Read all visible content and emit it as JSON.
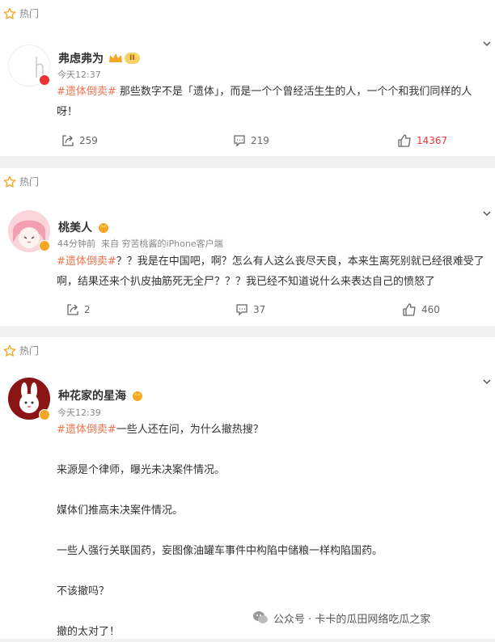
{
  "hot_label": "热门",
  "posts": [
    {
      "author": "弗虑弗为",
      "level": "II",
      "time": "今天12:37",
      "hashtag": "#遗体倒卖#",
      "body": " 那些数字不是「遗体」，而是一个个曾经活生生的人，一个个和我们同样的人呀！",
      "reposts": "259",
      "comments": "219",
      "likes": "14367"
    },
    {
      "author": "桃美人",
      "time_source": "44分钟前  来自 穷苦桃酱的iPhone客户端",
      "hashtag": "#遗体倒卖#",
      "body": "？？我是在中国吧，啊？怎么有人这么丧尽天良，本来生离死别就已经很难受了啊，结果还来个扒皮抽筋死无全尸？？？我已经不知道说什么来表达自己的愤怒了",
      "reposts": "2",
      "comments": "37",
      "likes": "460"
    },
    {
      "author": "种花家的星海",
      "time": "今天12:39",
      "hashtag": "#遗体倒卖#",
      "body": "一些人还在问，为什么撤热搜？",
      "paragraphs": [
        "来源是个律师，曝光未决案件情况。",
        "媒体们推高未决案件情况。",
        "一些人强行关联国药，妄图像油罐车事件中构陷中储粮一样构陷国药。",
        "不该撤吗？",
        "撤的太对了！"
      ]
    }
  ],
  "watermark": "公众号 · 卡卡的瓜田网络吃瓜之家",
  "colors": {
    "accent": "#eb7350",
    "like_active": "#e33",
    "muted": "#888"
  },
  "icons": [
    "star-icon",
    "chevron-down-icon",
    "repost-icon",
    "comment-icon",
    "like-icon",
    "verified-badge-icon",
    "crown-icon",
    "wechat-logo-icon"
  ]
}
